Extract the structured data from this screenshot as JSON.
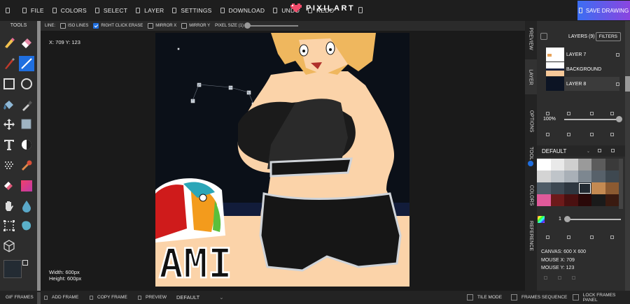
{
  "menu": {
    "file": "FILE",
    "colors": "COLORS",
    "select": "SELECT",
    "layer": "LAYER",
    "settings": "SETTINGS",
    "download": "DOWNLOAD",
    "undo": "UNDO",
    "redo": "REDO"
  },
  "app": {
    "name": "PIXILART",
    "save_label": "SAVE DRAWING"
  },
  "toolbar": {
    "title": "TOOLS",
    "tools": [
      "pencil-icon",
      "eraser-icon",
      "pen-icon",
      "line-icon",
      "rectangle-icon",
      "ellipse-icon",
      "fill-bucket-icon",
      "eyedropper-icon",
      "move-icon",
      "select-icon",
      "text-icon",
      "dither-icon",
      "pattern-icon",
      "stamp-icon",
      "color-replace-icon",
      "gradient-icon",
      "hand-icon",
      "droplet-icon",
      "crop-icon",
      "blob-icon",
      "cube-icon"
    ],
    "primary_color": "#232b33",
    "secondary_color": "#ffffff"
  },
  "options": {
    "line_label": "LINE:",
    "iso_lines": "ISO LINES",
    "right_click_erase": "RIGHT CLICK ERASE",
    "right_click_erase_checked": true,
    "mirror_x": "MIRROR X",
    "mirror_y": "MIRROR Y",
    "pixel_size": "PIXEL SIZE (1)"
  },
  "workspace": {
    "coords": "X: 709 Y: 123",
    "width": "Width: 600px",
    "height": "Height: 600px"
  },
  "sidetabs": [
    "PREVIEW",
    "LAYER",
    "OPTIONS",
    "TOOL",
    "COLORS",
    "REFERENCE"
  ],
  "layers": {
    "title": "LAYERS (9)",
    "filters": "FILTERS",
    "items": [
      {
        "name": "LAYER 7",
        "active": false
      },
      {
        "name": "BACKGROUND",
        "active": false
      },
      {
        "name": "LAYER 8",
        "active": true
      }
    ],
    "opacity": "100%"
  },
  "palette": {
    "name": "DEFAULT",
    "colors": [
      "#ffffff",
      "#e9e9e9",
      "#cfcfcf",
      "#9a9a9a",
      "#5c5c5c",
      "#3a3a3a",
      "#d4d4d4",
      "#bfc4c9",
      "#a9b0b7",
      "#7d8790",
      "#57616a",
      "#3e4850",
      "#4f5c67",
      "#3d4852",
      "#2e3740",
      "#222a32",
      "#c48a52",
      "#8c5a31",
      "#e05a9a",
      "#6d1a1a",
      "#4a1010",
      "#2a0808",
      "#1a1a1a",
      "#3a1a10"
    ],
    "selected_index": 15
  },
  "brush": {
    "size": "1"
  },
  "canvas_info": {
    "canvas": "CANVAS: 600 X 600",
    "mouse_x": "MOUSE X: 709",
    "mouse_y": "MOUSE Y: 123"
  },
  "bottom": {
    "gif_frames": "GIF FRAMES",
    "add_frame": "ADD FRAME",
    "copy_frame": "COPY FRAME",
    "preview": "PREVIEW",
    "default": "DEFAULT",
    "tile_mode": "TILE MODE",
    "frames_sequence": "FRAMES SEQUENCE",
    "lock_frames_panel": "LOCK FRAMES PANEL"
  },
  "artwork": {
    "letters": "AMI"
  }
}
